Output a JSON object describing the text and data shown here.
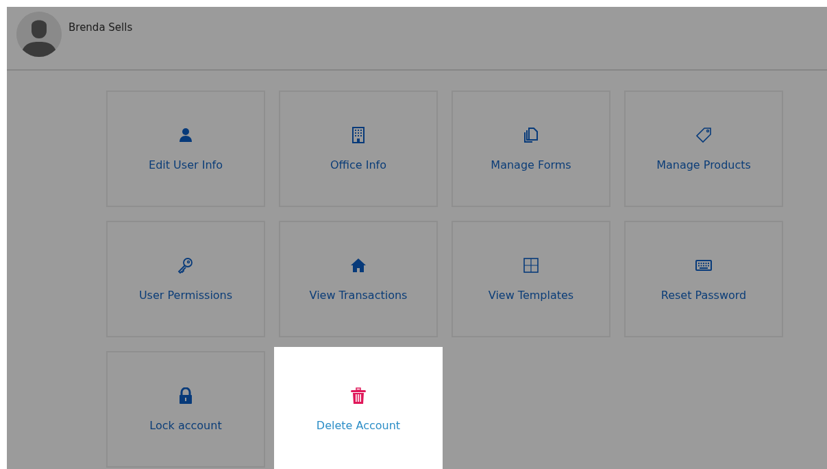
{
  "user": {
    "name": "Brenda Sells"
  },
  "tiles": [
    {
      "label": "Edit User Info",
      "kind": "person",
      "selected": false
    },
    {
      "label": "Office Info",
      "kind": "building",
      "selected": false
    },
    {
      "label": "Manage Forms",
      "kind": "copies",
      "selected": false
    },
    {
      "label": "Manage Products",
      "kind": "tag",
      "selected": false
    },
    {
      "label": "User Permissions",
      "kind": "key",
      "selected": false
    },
    {
      "label": "View Transactions",
      "kind": "house",
      "selected": false
    },
    {
      "label": "View Templates",
      "kind": "grid",
      "selected": false
    },
    {
      "label": "Reset Password",
      "kind": "keyboard",
      "selected": false
    },
    {
      "label": "Lock account",
      "kind": "lock",
      "selected": false
    },
    {
      "label": "Delete Account",
      "kind": "trash",
      "selected": true
    }
  ]
}
